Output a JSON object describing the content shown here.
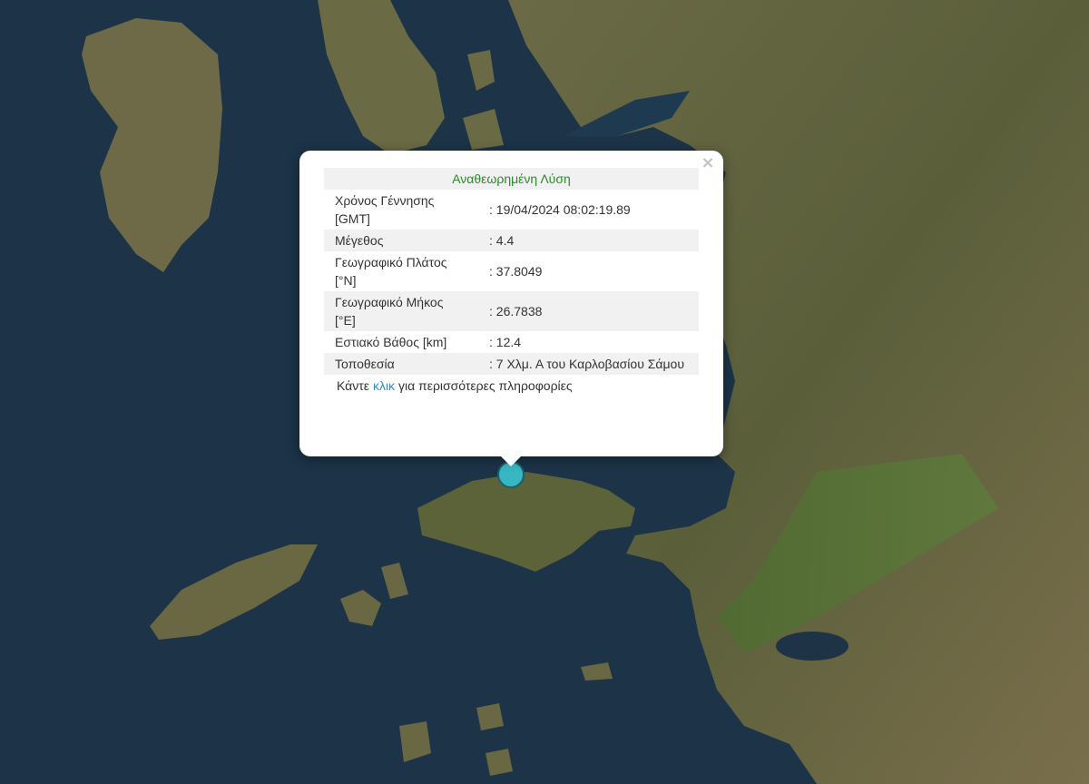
{
  "map": {
    "marker_color": "#35b8c2",
    "sea_color": "#1c3348"
  },
  "popup": {
    "heading": "Αναθεωρημένη Λύση",
    "rows": [
      {
        "label_line1": "Χρόνος Γέννησης",
        "label_line2": "[GMT]",
        "value": ": 19/04/2024 08:02:19.89"
      },
      {
        "label_line1": "Μέγεθος",
        "label_line2": "",
        "value": ": 4.4"
      },
      {
        "label_line1": "Γεωγραφικό Πλάτος",
        "label_line2": "[°N]",
        "value": ": 37.8049"
      },
      {
        "label_line1": "Γεωγραφικό Μήκος",
        "label_line2": "[°E]",
        "value": ": 26.7838"
      },
      {
        "label_line1": "Εστιακό Βάθος [km]",
        "label_line2": "",
        "value": ": 12.4"
      },
      {
        "label_line1": "Τοποθεσία",
        "label_line2": "",
        "value": ": 7 Χλμ. Α του Καρλοβασίου Σάμου"
      }
    ],
    "more_prefix": "Κάντε",
    "more_link": "κλικ",
    "more_suffix": "για περισσότερες πληροφορίες",
    "close_symbol": "×"
  }
}
